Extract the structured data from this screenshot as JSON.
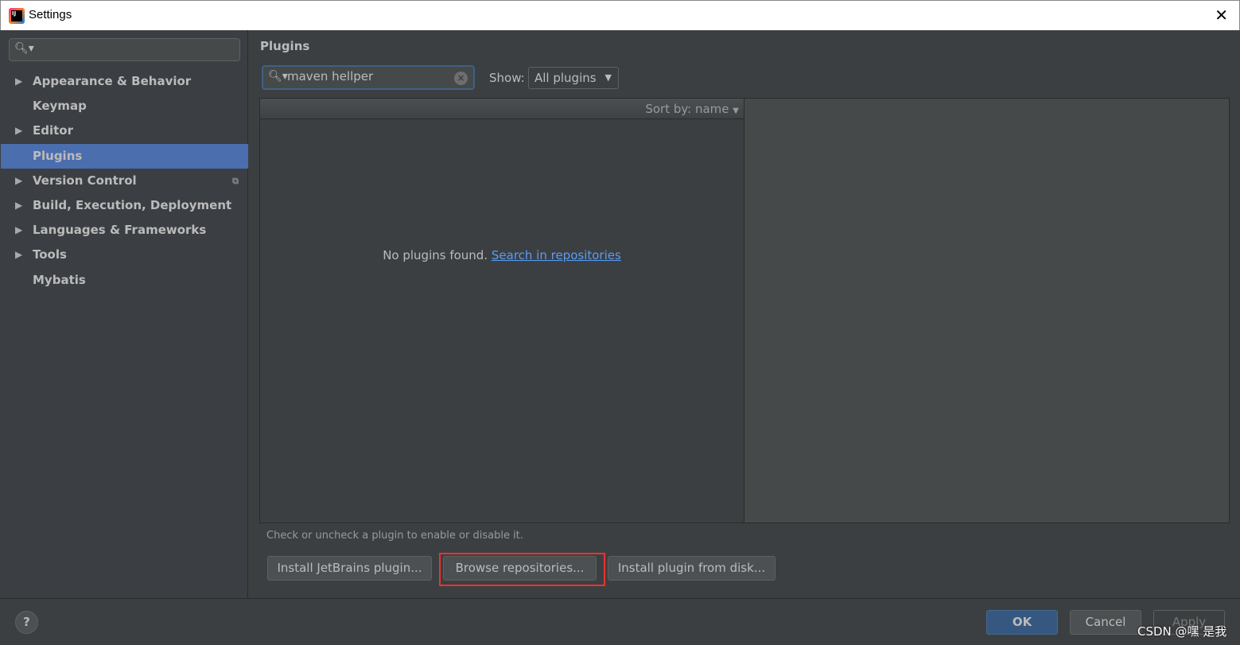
{
  "window": {
    "title": "Settings",
    "logo_text": "IJ"
  },
  "sidebar": {
    "search_placeholder": "",
    "items": [
      {
        "label": "Appearance & Behavior",
        "expandable": true
      },
      {
        "label": "Keymap",
        "expandable": false
      },
      {
        "label": "Editor",
        "expandable": true
      },
      {
        "label": "Plugins",
        "expandable": false,
        "selected": true
      },
      {
        "label": "Version Control",
        "expandable": true,
        "has_copy_icon": true
      },
      {
        "label": "Build, Execution, Deployment",
        "expandable": true
      },
      {
        "label": "Languages & Frameworks",
        "expandable": true
      },
      {
        "label": "Tools",
        "expandable": true
      },
      {
        "label": "Mybatis",
        "expandable": false
      }
    ]
  },
  "main": {
    "title": "Plugins",
    "search_value": "maven hellper",
    "show_label": "Show:",
    "show_value": "All plugins",
    "sort_label": "Sort by: name",
    "empty_text": "No plugins found.",
    "empty_link": "Search in repositories",
    "hint": "Check or uncheck a plugin to enable or disable it.",
    "buttons": {
      "install_jetbrains": "Install JetBrains plugin...",
      "browse": "Browse repositories...",
      "install_disk": "Install plugin from disk..."
    }
  },
  "footer": {
    "help": "?",
    "ok": "OK",
    "cancel": "Cancel",
    "apply": "Apply"
  },
  "watermark": "CSDN @嘿 是我",
  "colors": {
    "selection": "#4b6eaf",
    "highlight_box": "#f03030",
    "link": "#589df6"
  }
}
